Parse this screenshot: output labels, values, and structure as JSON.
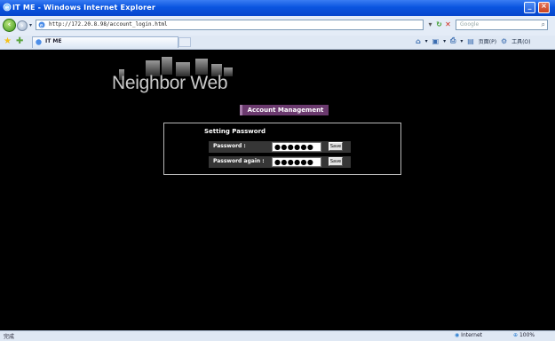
{
  "window": {
    "title": "IT ME - Windows Internet Explorer",
    "accent": "#0b55e0"
  },
  "toolbar": {
    "url": "http://172.20.8.98/account_login.html",
    "search_placeholder": "Google",
    "nav_back_icon": "back-arrow-icon",
    "nav_forward_icon": "forward-arrow-icon"
  },
  "tabs": {
    "active_label": "IT ME"
  },
  "command_bar": {
    "page_label": "页面(P)",
    "tools_label": "工具(O)"
  },
  "page": {
    "logo_text": "Neighbor Web",
    "section_tab": "Account Management",
    "section_color": "#6b3a6e",
    "panel_title": "Setting Password",
    "fields": [
      {
        "label": "Password :",
        "value": "●●●●●●",
        "button": "Save"
      },
      {
        "label": "Password again :",
        "value": "●●●●●●",
        "button": "Save"
      }
    ]
  },
  "status": {
    "left": "完成",
    "zone": "Internet",
    "zoom": "100%"
  }
}
